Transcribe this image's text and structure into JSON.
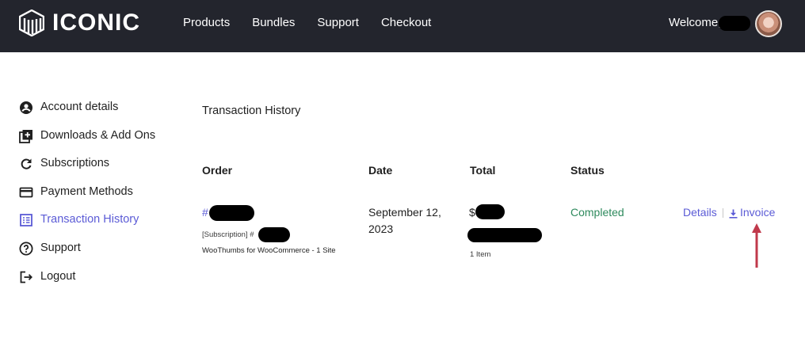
{
  "brand": {
    "name": "ICONIC"
  },
  "nav": {
    "items": [
      "Products",
      "Bundles",
      "Support",
      "Checkout"
    ]
  },
  "user": {
    "welcome": "Welcome,"
  },
  "sidebar": {
    "items": [
      {
        "label": "Account details",
        "icon": "account-circle-icon"
      },
      {
        "label": "Downloads & Add Ons",
        "icon": "downloads-add-icon"
      },
      {
        "label": "Subscriptions",
        "icon": "refresh-icon"
      },
      {
        "label": "Payment Methods",
        "icon": "credit-card-icon"
      },
      {
        "label": "Transaction History",
        "icon": "list-table-icon",
        "active": true
      },
      {
        "label": "Support",
        "icon": "help-circle-icon"
      },
      {
        "label": "Logout",
        "icon": "logout-icon"
      }
    ]
  },
  "main": {
    "title": "Transaction History",
    "columns": {
      "order": "Order",
      "date": "Date",
      "total": "Total",
      "status": "Status"
    },
    "rows": [
      {
        "order_prefix": "#",
        "subscription_label": "[Subscription] #",
        "product": "WooThumbs for WooCommerce - 1 Site",
        "date": "September 12, 2023",
        "total_prefix": "$",
        "items": "1 Item",
        "status": "Completed",
        "actions": {
          "details": "Details",
          "invoice": "Invoice"
        }
      }
    ]
  },
  "colors": {
    "header_bg": "#23252d",
    "accent": "#5b5bd6",
    "status_completed": "#2e8a5d",
    "annotation_arrow": "#c0394b"
  }
}
